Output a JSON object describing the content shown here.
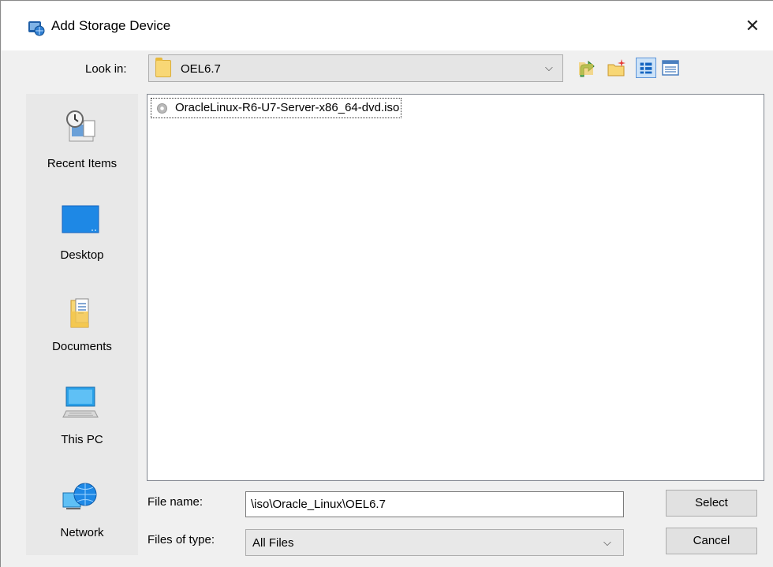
{
  "window": {
    "title": "Add Storage Device",
    "close_glyph": "✕"
  },
  "lookin": {
    "label": "Look in:",
    "value": "OEL6.7",
    "chevron": "⌵"
  },
  "toolbar": {
    "buttons": [
      {
        "name": "up-one-level-icon"
      },
      {
        "name": "create-new-folder-icon"
      },
      {
        "name": "list-view-icon"
      },
      {
        "name": "details-view-icon"
      }
    ]
  },
  "places": [
    {
      "label": "Recent Items",
      "icon": "recent-items-icon"
    },
    {
      "label": "Desktop",
      "icon": "desktop-icon"
    },
    {
      "label": "Documents",
      "icon": "documents-icon"
    },
    {
      "label": "This PC",
      "icon": "this-pc-icon"
    },
    {
      "label": "Network",
      "icon": "network-icon"
    }
  ],
  "files": [
    {
      "name": "OracleLinux-R6-U7-Server-x86_64-dvd.iso",
      "icon": "disc-image-icon"
    }
  ],
  "file_name": {
    "label": "File name:",
    "value": "\\iso\\Oracle_Linux\\OEL6.7"
  },
  "file_type": {
    "label": "Files of type:",
    "value": "All Files",
    "chevron": "⌵"
  },
  "buttons": {
    "select": "Select",
    "cancel": "Cancel"
  },
  "colors": {
    "accent": "#5b93d8",
    "folder": "#f8d775",
    "desktop": "#1e88e5"
  }
}
